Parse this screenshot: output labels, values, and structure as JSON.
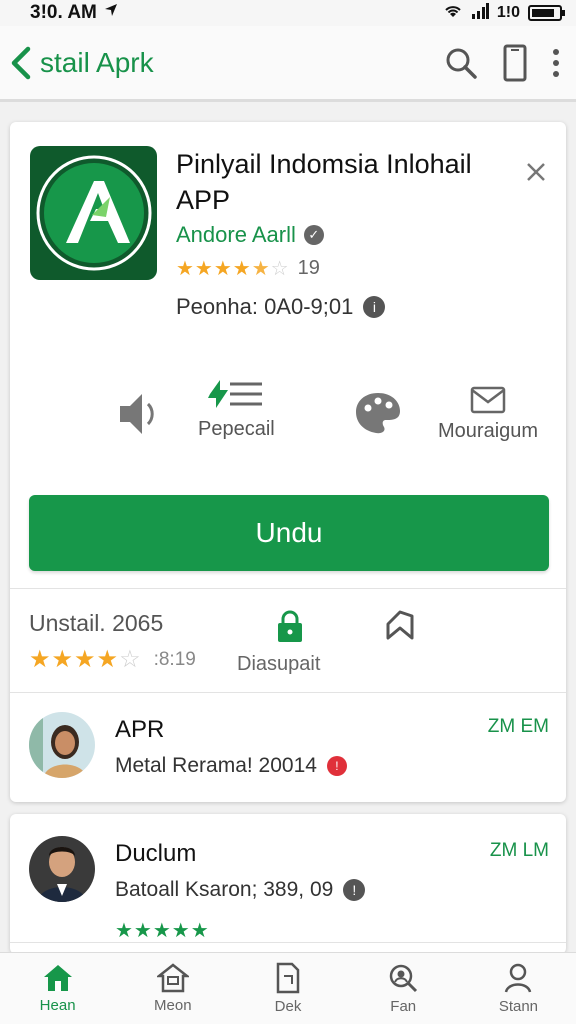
{
  "status_bar": {
    "time": "3!0. AM",
    "network": "1!0"
  },
  "app_bar": {
    "title": "stail Aprk",
    "back_icon": "chevron-left-icon",
    "actions": [
      "search-icon",
      "phone-icon",
      "more-vert-icon"
    ]
  },
  "app": {
    "title": "Pinlyail Indomsia Inlohail APP",
    "developer": "Andore Aarll",
    "rating_stars": 4.5,
    "rating_count": "19",
    "price_line": "Peonha: 0A0-9;01",
    "close_icon": "close-icon"
  },
  "features": [
    {
      "icon": "speaker-icon",
      "label": ""
    },
    {
      "icon": "list-icon",
      "label": "Pepecail"
    },
    {
      "icon": "palette-icon",
      "label": ""
    },
    {
      "icon": "mail-icon",
      "label": "Mouraigum"
    }
  ],
  "install_button": {
    "label": "Undu"
  },
  "meta": {
    "title": "Unstail. 2065",
    "stars": 3.5,
    "count": ":8:19",
    "download_label": "Diasupait",
    "lock_icon": "lock-icon",
    "tag_icon": "tag-icon"
  },
  "reviews": [
    {
      "name": "APR",
      "sub": "Metal Rerama! 20014",
      "time": "ZM EM",
      "badge": "!"
    },
    {
      "name": "Duclum",
      "sub": "Batoall Ksaron; 389, 09",
      "time": "ZM LM",
      "badge": "!",
      "stars": 5
    }
  ],
  "bottom_nav": [
    {
      "label": "Hean",
      "icon": "home-icon",
      "active": true
    },
    {
      "label": "Meon",
      "icon": "store-icon",
      "active": false
    },
    {
      "label": "Dek",
      "icon": "document-icon",
      "active": false
    },
    {
      "label": "Fan",
      "icon": "search-people-icon",
      "active": false
    },
    {
      "label": "Stann",
      "icon": "person-icon",
      "active": false
    }
  ],
  "colors": {
    "accent": "#17974a",
    "star": "#f5a623",
    "background": "#f1f1f1"
  }
}
